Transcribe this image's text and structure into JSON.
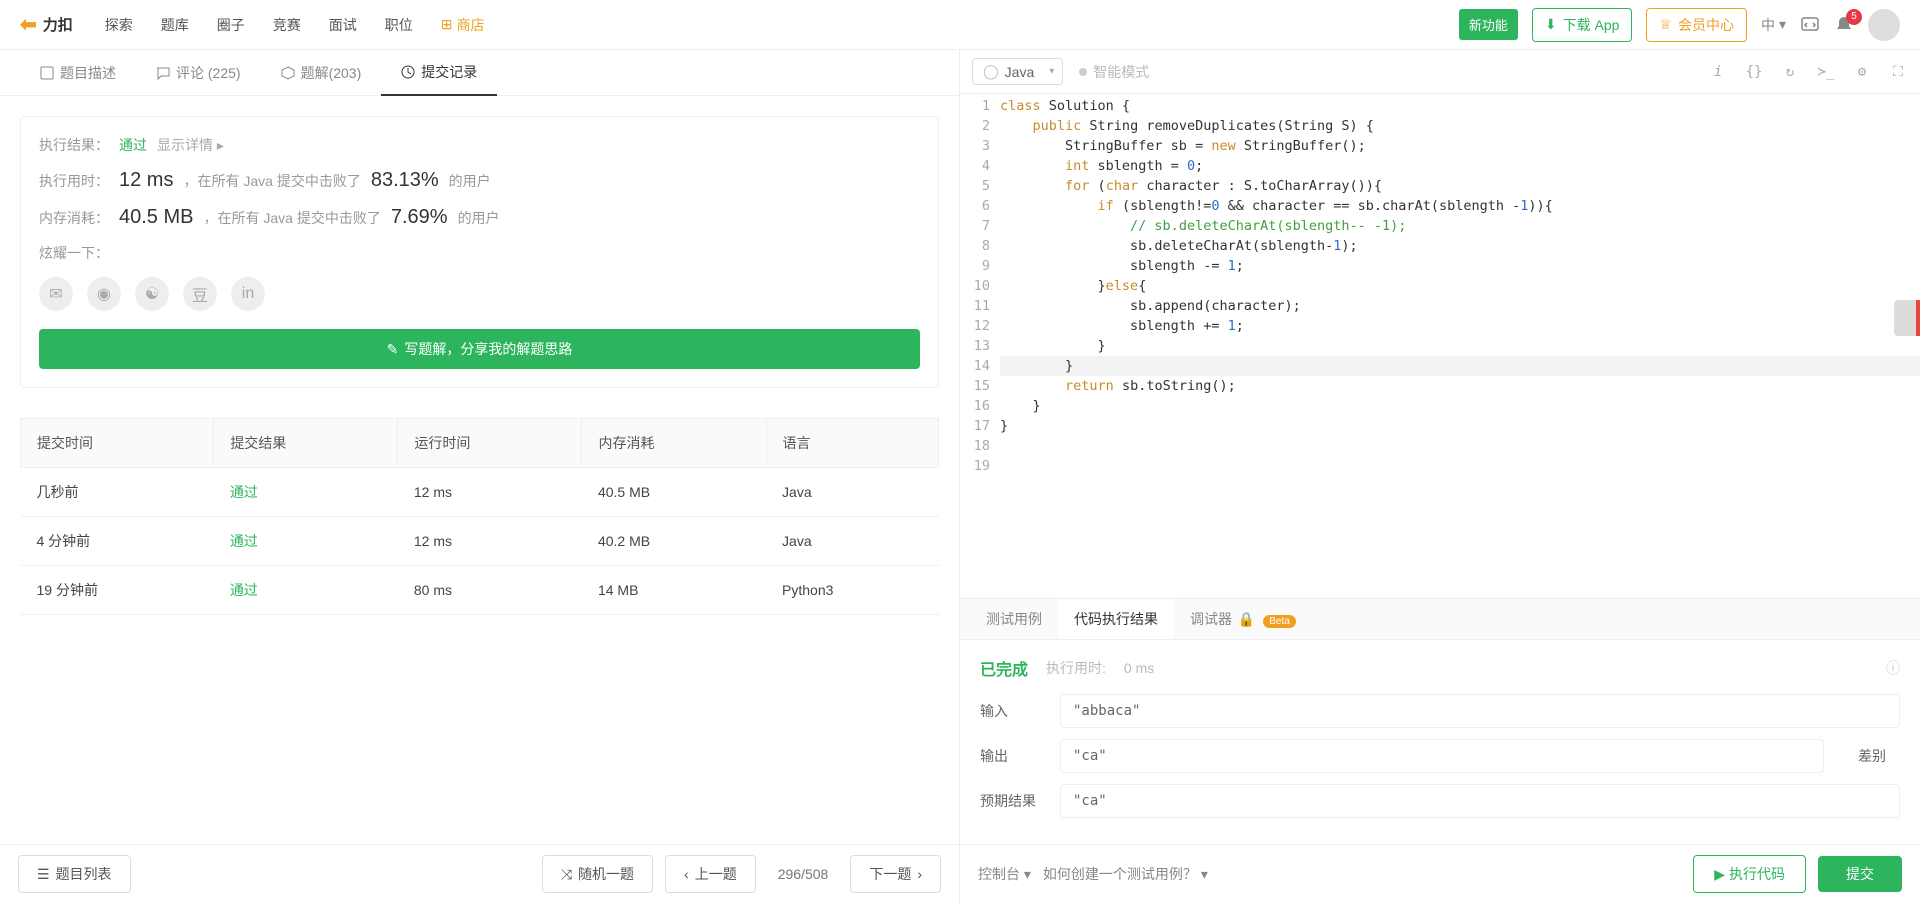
{
  "topNav": {
    "brand": "力扣",
    "items": [
      "探索",
      "题库",
      "圈子",
      "竞赛",
      "面试",
      "职位"
    ],
    "shop": "商店",
    "newFeature": "新功能",
    "download": "下载 App",
    "memberCenter": "会员中心",
    "lang": "中",
    "notifications": 5
  },
  "problemTabs": {
    "description": "题目描述",
    "comments": "评论 (225)",
    "solutions": "题解(203)",
    "submissions": "提交记录"
  },
  "result": {
    "execResultLabel": "执行结果：",
    "status": "通过",
    "showDetails": "显示详情 ▸",
    "timeLabel": "执行用时：",
    "time": "12 ms",
    "timeDesc": "，在所有 Java 提交中击败了",
    "timeUsers": "的用户",
    "timePct": "83.13%",
    "memLabel": "内存消耗：",
    "mem": "40.5 MB",
    "memDesc": "，在所有 Java 提交中击败了",
    "memPct": "7.69%",
    "memUsers": "的用户",
    "showoff": "炫耀一下：",
    "writeSolution": "写题解，分享我的解题思路"
  },
  "table": {
    "headers": [
      "提交时间",
      "提交结果",
      "运行时间",
      "内存消耗",
      "语言"
    ],
    "rows": [
      {
        "time": "几秒前",
        "status": "通过",
        "runtime": "12 ms",
        "memory": "40.5 MB",
        "lang": "Java"
      },
      {
        "time": "4 分钟前",
        "status": "通过",
        "runtime": "12 ms",
        "memory": "40.2 MB",
        "lang": "Java"
      },
      {
        "time": "19 分钟前",
        "status": "通过",
        "runtime": "80 ms",
        "memory": "14 MB",
        "lang": "Python3"
      }
    ]
  },
  "editor": {
    "language": "Java",
    "smartMode": "智能模式"
  },
  "resultTabs": {
    "testcase": "测试用例",
    "output": "代码执行结果",
    "debugger": "调试器",
    "beta": "Beta"
  },
  "exec": {
    "done": "已完成",
    "timeLabel": "执行用时:",
    "time": "0 ms",
    "inputLabel": "输入",
    "inputVal": "\"abbaca\"",
    "outputLabel": "输出",
    "outputVal": "\"ca\"",
    "expectedLabel": "预期结果",
    "expectedVal": "\"ca\"",
    "diff": "差别"
  },
  "bottom": {
    "problemList": "题目列表",
    "random": "随机一题",
    "prev": "上一题",
    "counter": "296/508",
    "next": "下一题",
    "console": "控制台",
    "testHint": "如何创建一个测试用例？",
    "run": "执行代码",
    "submit": "提交"
  }
}
